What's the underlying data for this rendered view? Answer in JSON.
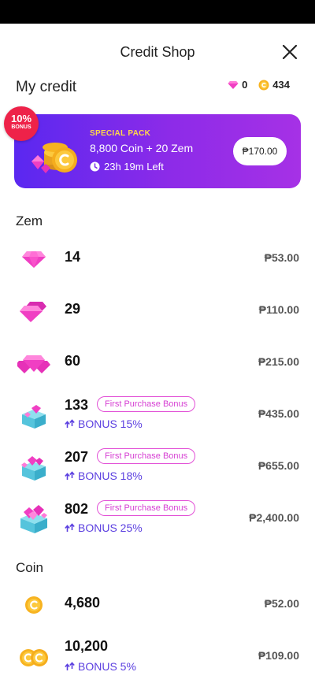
{
  "header": {
    "title": "Credit Shop"
  },
  "credit": {
    "label": "My credit",
    "zem_balance": "0",
    "coin_balance": "434"
  },
  "special_pack": {
    "badge_percent": "10%",
    "badge_text": "BONUS",
    "kicker": "SPECIAL PACK",
    "title": "8,800 Coin + 20 Zem",
    "timer": "23h 19m Left",
    "price": "₱170.00"
  },
  "zem": {
    "title": "Zem",
    "items": [
      {
        "amount": "14",
        "price": "₱53.00"
      },
      {
        "amount": "29",
        "price": "₱110.00"
      },
      {
        "amount": "60",
        "price": "₱215.00"
      },
      {
        "amount": "133",
        "chip": "First Purchase Bonus",
        "bonus": "BONUS 15%",
        "price": "₱435.00"
      },
      {
        "amount": "207",
        "chip": "First Purchase Bonus",
        "bonus": "BONUS 18%",
        "price": "₱655.00"
      },
      {
        "amount": "802",
        "chip": "First Purchase Bonus",
        "bonus": "BONUS 25%",
        "price": "₱2,400.00"
      }
    ]
  },
  "coin": {
    "title": "Coin",
    "items": [
      {
        "amount": "4,680",
        "price": "₱52.00"
      },
      {
        "amount": "10,200",
        "bonus": "BONUS 5%",
        "price": "₱109.00"
      }
    ]
  },
  "colors": {
    "accent_purple": "#5a28f0",
    "accent_pink": "#e24fd6",
    "badge_red": "#ee2249",
    "coin_gold": "#f7b320"
  }
}
